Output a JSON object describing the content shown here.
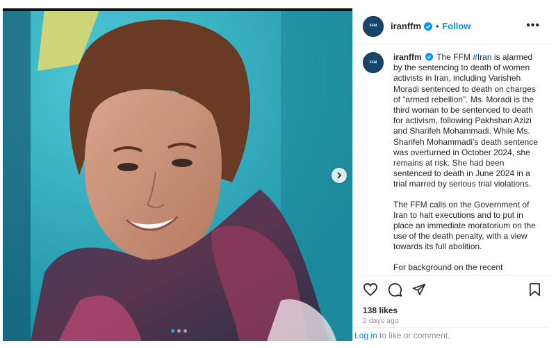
{
  "post": {
    "username": "iranffm",
    "follow_label": "Follow",
    "separator": "•",
    "more_label": "•••",
    "avatar_text": "FFM",
    "caption": {
      "username": "iranffm",
      "intro": "The FFM ",
      "hashtag": "#Iran",
      "para1_rest": " is alarmed by the sentencing to death of women activists in Iran, including Varisheh Moradi sentenced to death on charges of “armed rebellion”. Ms. Moradi is the third woman to be sentenced to death for activism, following Pakhshan Azizi and Sharifeh Mohammadi. While Ms. Sharifeh Mohammadi’s death sentence was overturned in October 2024, she remains at risk. She had been sentenced to death in June 2024 in a trial marred by serious trial violations.",
      "para2": "The FFM calls on the Government of Iran to halt executions and to put in place an immediate moratorium on the use of the death penalty, with a view towards its full abolition.",
      "para3": "For background on the recent"
    },
    "likes": "138 likes",
    "time": "2 days ago",
    "login_link": "Log in",
    "login_rest": " to like or comment."
  },
  "colors": {
    "accent": "#0095f6",
    "avatar_bg": "#16456b",
    "photo_bg": "#25a6bd"
  },
  "icons": [
    "verified-badge-icon",
    "more-options-icon",
    "heart-icon",
    "comment-icon",
    "share-icon",
    "bookmark-icon",
    "chevron-right-icon"
  ]
}
